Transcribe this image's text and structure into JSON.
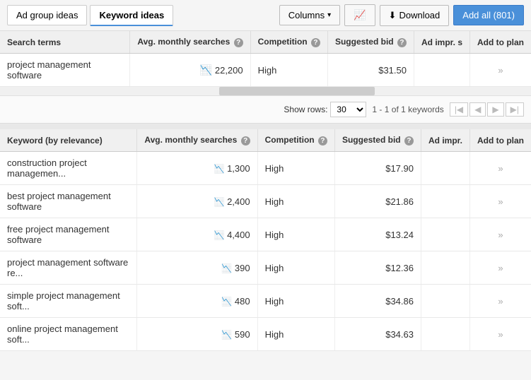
{
  "tabs": {
    "ad_group": "Ad group ideas",
    "keyword": "Keyword ideas"
  },
  "toolbar": {
    "columns_label": "Columns",
    "download_label": "Download",
    "add_all_label": "Add all (801)"
  },
  "search_table": {
    "headers": {
      "search_terms": "Search terms",
      "avg_monthly": "Avg. monthly searches",
      "competition": "Competition",
      "suggested_bid": "Suggested bid",
      "ad_impr": "Ad impr. s",
      "add_to_plan": "Add to plan"
    },
    "rows": [
      {
        "term": "project management software",
        "monthly": "22,200",
        "competition": "High",
        "bid": "$31.50",
        "add": "»"
      }
    ]
  },
  "pagination": {
    "show_rows_label": "Show rows:",
    "rows_value": "30",
    "page_info": "1 - 1 of 1 keywords"
  },
  "keyword_table": {
    "headers": {
      "keyword": "Keyword (by relevance)",
      "avg_monthly": "Avg. monthly searches",
      "competition": "Competition",
      "suggested_bid": "Suggested bid",
      "ad_impr": "Ad impr.",
      "add_to_plan": "Add to plan"
    },
    "rows": [
      {
        "keyword": "construction project managemen...",
        "monthly": "1,300",
        "competition": "High",
        "bid": "$17.90",
        "add": "»"
      },
      {
        "keyword": "best project management software",
        "monthly": "2,400",
        "competition": "High",
        "bid": "$21.86",
        "add": "»"
      },
      {
        "keyword": "free project management software",
        "monthly": "4,400",
        "competition": "High",
        "bid": "$13.24",
        "add": "»"
      },
      {
        "keyword": "project management software re...",
        "monthly": "390",
        "competition": "High",
        "bid": "$12.36",
        "add": "»"
      },
      {
        "keyword": "simple project management soft...",
        "monthly": "480",
        "competition": "High",
        "bid": "$34.86",
        "add": "»"
      },
      {
        "keyword": "online project management soft...",
        "monthly": "590",
        "competition": "High",
        "bid": "$34.63",
        "add": "»"
      }
    ]
  }
}
